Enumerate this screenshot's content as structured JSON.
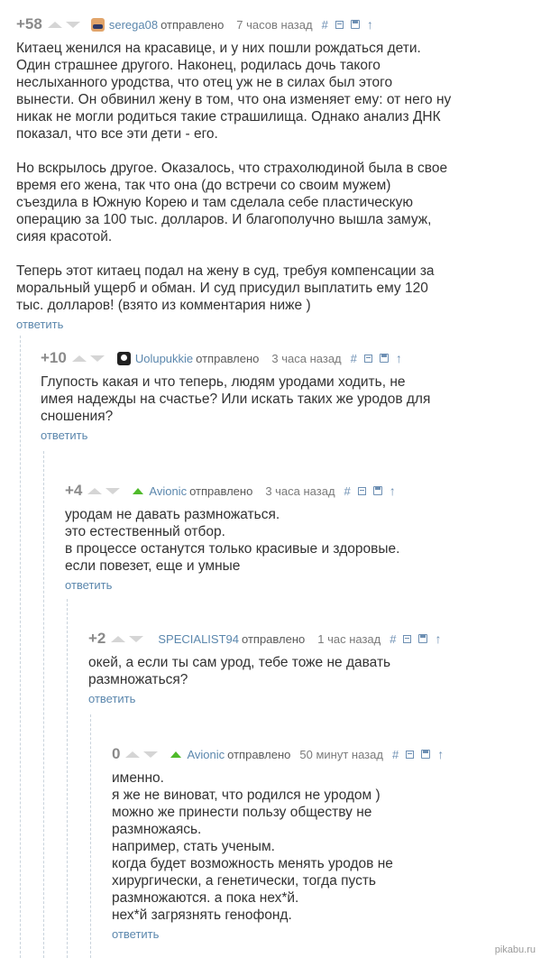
{
  "comments": [
    {
      "rating": "+58",
      "author": "serega08",
      "sent": "отправлено",
      "time": "7 часов назад",
      "hash": "#",
      "body": "Китаец женился на красавице, и у них пошли рождаться дети. Один страшнее другого. Наконец, родилась дочь такого неслыханного уродства, что отец уж не в силах был этого вынести. Он обвинил жену в том, что она изменяет ему: от него ну никак не могли родиться такие страшилища. Однако анализ ДНК показал, что все эти дети - его.\n\nНо вскрылось другое. Оказалось, что страхолюдиной была в свое время его жена, так что она (до встречи со своим мужем) съездила в Южную Корею и там сделала себе пластическую операцию за 100 тыс. долларов. И благополучно вышла замуж, сияя красотой.\n\nТеперь этот китаец подал на жену в суд, требуя компенсации за моральный ущерб и обман. И суд присудил выплатить ему 120 тыс. долларов! (взято из комментария ниже )",
      "reply": "ответить"
    },
    {
      "rating": "+10",
      "author": "Uolupukkie",
      "sent": "отправлено",
      "time": "3 часа назад",
      "hash": "#",
      "body": "Глупость какая и что теперь, людям уродами ходить, не имея надежды на счастье? Или искать таких же уродов для сношения?",
      "reply": "ответить"
    },
    {
      "rating": "+4",
      "author": "Avionic",
      "sent": "отправлено",
      "time": "3 часа назад",
      "hash": "#",
      "body": "уродам не давать размножаться.\nэто естественный отбор.\nв процессе останутся только красивые и здоровые.\nесли повезет, еще и умные",
      "reply": "ответить"
    },
    {
      "rating": "+2",
      "author": "SPECIALIST94",
      "sent": "отправлено",
      "time": "1 час назад",
      "hash": "#",
      "body": "окей, а если ты сам урод, тебе тоже не давать размножаться?",
      "reply": "ответить"
    },
    {
      "rating": "0",
      "author": "Avionic",
      "sent": "отправлено",
      "time": "50 минут назад",
      "hash": "#",
      "body": "именно.\nя же не виноват, что родился не уродом )\nможно же принести пользу обществу не размножаясь.\nнапример, стать ученым.\nкогда будет возможность менять уродов не хирургически, а генетически, тогда пусть размножаются. а пока нех*й.\nнех*й загрязнять генофонд.",
      "reply": "ответить"
    }
  ],
  "watermark": "pikabu.ru",
  "colors": {
    "author": "#5b87ad",
    "rating": "#8a8a8a",
    "vote": "#d5d5d5",
    "badge": "#4fba2a",
    "thread_line": "#c9d3dc"
  },
  "icons": [
    "hash-link-icon",
    "collapse-icon",
    "save-icon",
    "arrow-up-icon"
  ]
}
